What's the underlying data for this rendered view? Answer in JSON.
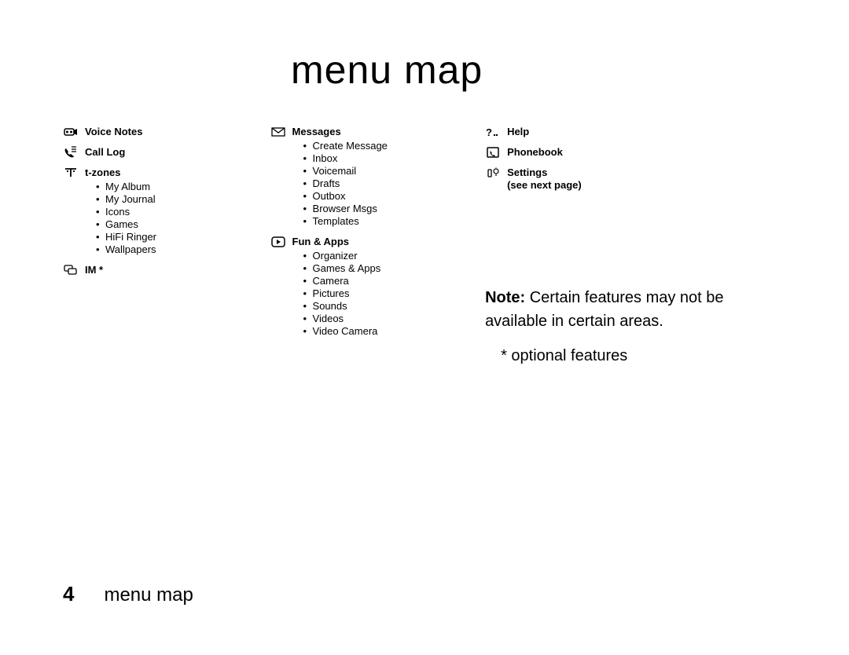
{
  "title": "menu map",
  "footer": {
    "page": "4",
    "label": "menu map"
  },
  "col1": {
    "voicenotes": {
      "title": "Voice Notes"
    },
    "calllog": {
      "title": "Call Log"
    },
    "tzones": {
      "title": "t-zones",
      "items": [
        "My Album",
        "My Journal",
        "Icons",
        "Games",
        "HiFi Ringer",
        "Wallpapers"
      ]
    },
    "im": {
      "title": "IM *"
    }
  },
  "col2": {
    "messages": {
      "title": "Messages",
      "items": [
        "Create Message",
        "Inbox",
        "Voicemail",
        "Drafts",
        "Outbox",
        "Browser Msgs",
        "Templates"
      ]
    },
    "funapps": {
      "title": "Fun & Apps",
      "items": [
        "Organizer",
        "Games & Apps",
        "Camera",
        "Pictures",
        "Sounds",
        "Videos",
        "Video Camera"
      ]
    }
  },
  "col3": {
    "help": {
      "title": "Help"
    },
    "phonebook": {
      "title": "Phonebook"
    },
    "settings": {
      "title": "Settings",
      "subtitle": "(see next page)"
    }
  },
  "note": {
    "label": "Note:",
    "text": " Certain features may not be available in certain areas."
  },
  "optional": "*  optional features"
}
